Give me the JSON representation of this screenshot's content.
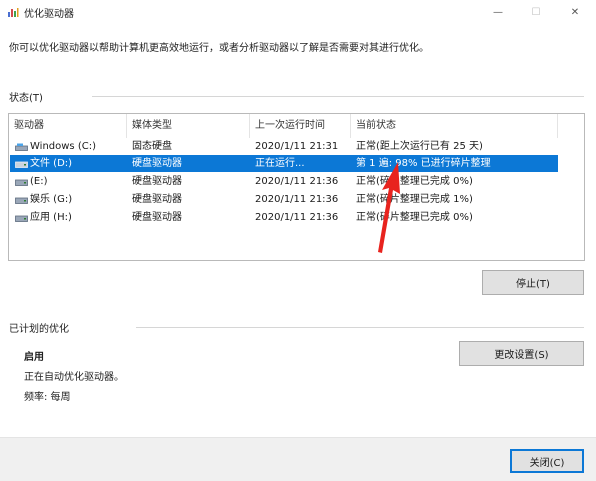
{
  "window": {
    "title": "优化驱动器",
    "controls": {
      "minimize": "—",
      "maximize": "☐",
      "close": "✕"
    }
  },
  "description": "你可以优化驱动器以帮助计算机更高效地运行，或者分析驱动器以了解是否需要对其进行优化。",
  "status_section": {
    "label": "状态(T)",
    "columns": [
      "驱动器",
      "媒体类型",
      "上一次运行时间",
      "当前状态"
    ],
    "rows": [
      {
        "drive": "Windows (C:)",
        "media": "固态硬盘",
        "last_run": "2020/1/11 21:31",
        "status": "正常(距上次运行已有 25 天)",
        "icon": "ssd-drive-icon",
        "selected": false
      },
      {
        "drive": "文件 (D:)",
        "media": "硬盘驱动器",
        "last_run": "正在运行...",
        "status": "第 1 遍: 98% 已进行碎片整理",
        "icon": "hdd-drive-icon",
        "selected": true
      },
      {
        "drive": "(E:)",
        "media": "硬盘驱动器",
        "last_run": "2020/1/11 21:36",
        "status": "正常(碎片整理已完成 0%)",
        "icon": "hdd-drive-icon",
        "selected": false
      },
      {
        "drive": "娱乐 (G:)",
        "media": "硬盘驱动器",
        "last_run": "2020/1/11 21:36",
        "status": "正常(碎片整理已完成 1%)",
        "icon": "hdd-drive-icon",
        "selected": false
      },
      {
        "drive": "应用 (H:)",
        "media": "硬盘驱动器",
        "last_run": "2020/1/11 21:36",
        "status": "正常(碎片整理已完成 0%)",
        "icon": "hdd-drive-icon",
        "selected": false
      }
    ],
    "stop_button": "停止(T)"
  },
  "scheduled_section": {
    "label": "已计划的优化",
    "state": "启用",
    "line1": "正在自动优化驱动器。",
    "line2": "频率: 每周",
    "change_button": "更改设置(S)"
  },
  "footer": {
    "close_button": "关闭(C)"
  },
  "colors": {
    "selection": "#0c78d6",
    "annotation_arrow": "#e8231e"
  }
}
